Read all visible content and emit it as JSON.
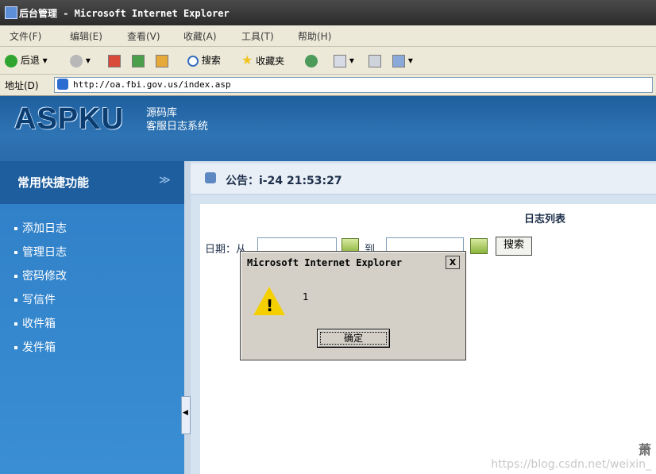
{
  "window": {
    "title": "后台管理 - Microsoft Internet Explorer"
  },
  "menu": [
    "文件(F)",
    "编辑(E)",
    "查看(V)",
    "收藏(A)",
    "工具(T)",
    "帮助(H)"
  ],
  "toolbar": {
    "back": "后退",
    "search": "搜索",
    "favorites": "收藏夹"
  },
  "address": {
    "label": "地址(D)",
    "url": "http://oa.fbi.gov.us/index.asp"
  },
  "banner": {
    "logo": "ASPKU",
    "line1": "源码库",
    "line2": "客服日志系统"
  },
  "sidebar": {
    "title": "常用快捷功能",
    "chevron": "≫",
    "items": [
      {
        "label": "添加日志"
      },
      {
        "label": "管理日志"
      },
      {
        "label": "密码修改"
      },
      {
        "label": "写信件"
      },
      {
        "label": "收件箱"
      },
      {
        "label": "发件箱"
      }
    ]
  },
  "notice": {
    "text": "公告：i-24 21:53:27"
  },
  "list": {
    "title": "日志列表",
    "date_label": "日期：从",
    "to_label": "到",
    "search_button": "搜索"
  },
  "dialog": {
    "title": "Microsoft Internet Explorer",
    "message": "1",
    "ok_label": "确定",
    "close": "X"
  },
  "watermark": {
    "name": "萧",
    "url": "https://blog.csdn.net/weixin_"
  }
}
